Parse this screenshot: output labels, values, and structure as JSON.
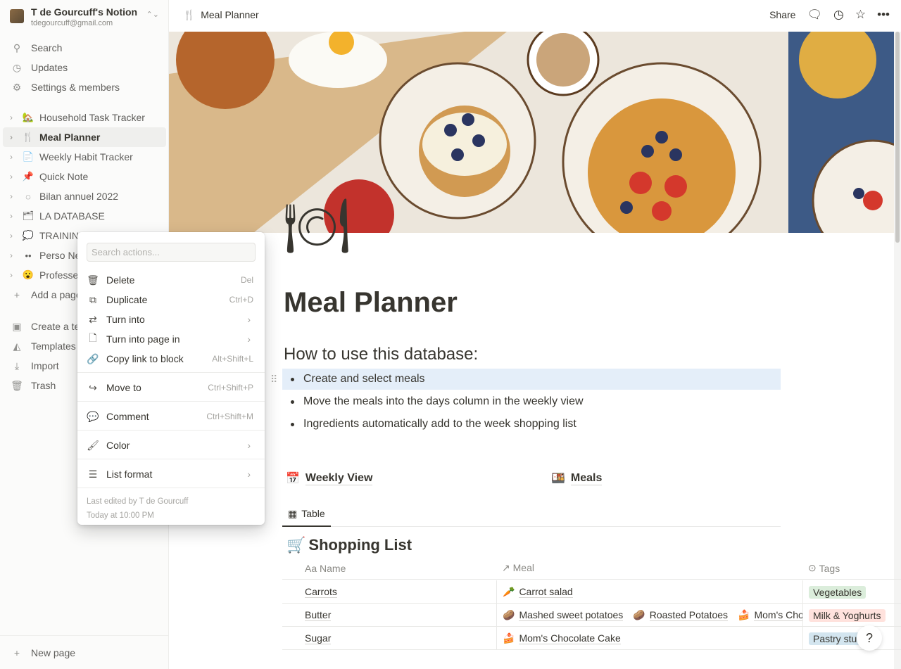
{
  "workspace": {
    "name": "T de Gourcuff's Notion",
    "email": "tdegourcuff@gmail.com"
  },
  "sidebar": {
    "top": [
      {
        "icon": "search-icon",
        "label": "Search"
      },
      {
        "icon": "clock-icon",
        "label": "Updates"
      },
      {
        "icon": "gear-icon",
        "label": "Settings & members"
      }
    ],
    "pages": [
      {
        "emoji": "🏡",
        "label": "Household Task Tracker"
      },
      {
        "emoji": "🍴",
        "label": "Meal Planner",
        "active": true
      },
      {
        "emoji": "📄",
        "label": "Weekly Habit Tracker"
      },
      {
        "emoji": "📌",
        "label": "Quick Note"
      },
      {
        "emoji": "◌",
        "label": "Bilan annuel 2022"
      },
      {
        "emoji": "🗂",
        "label": "LA DATABASE"
      },
      {
        "emoji": "💭",
        "label": "TRAINING"
      },
      {
        "emoji": "••",
        "label": "Perso Ne"
      },
      {
        "emoji": "😮",
        "label": "Professe"
      }
    ],
    "add_page": "Add a page",
    "bottom": [
      {
        "icon": "template-icon",
        "label": "Create a te"
      },
      {
        "icon": "shapes-icon",
        "label": "Templates"
      },
      {
        "icon": "download-icon",
        "label": "Import"
      },
      {
        "icon": "trash-icon",
        "label": "Trash"
      }
    ],
    "new_page": "New page"
  },
  "topbar": {
    "breadcrumb": "Meal Planner",
    "breadcrumb_icon": "🍴",
    "share": "Share"
  },
  "page": {
    "icon": "🍽",
    "title": "Meal Planner",
    "heading": "How to use this database:",
    "bullets": [
      "Create and select meals",
      "Move the meals into the days column in the weekly view",
      "Ingredients automatically add to the week shopping list"
    ],
    "linked": [
      {
        "emoji": "📅",
        "label": "Weekly View"
      },
      {
        "emoji": "🍱",
        "label": "Meals"
      }
    ],
    "view_tab": "Table",
    "db_title": "Shopping List",
    "db_emoji": "🛒",
    "columns": [
      "Aa Name",
      "↗ Meal",
      "Tags"
    ],
    "rows": [
      {
        "name": "Carrots",
        "meals": [
          {
            "e": "🥕",
            "t": "Carrot salad"
          }
        ],
        "tag": "Vegetables",
        "tag_color": "#dbeddb"
      },
      {
        "name": "Butter",
        "meals": [
          {
            "e": "🥔",
            "t": "Mashed sweet potatoes"
          },
          {
            "e": "🥔",
            "t": "Roasted Potatoes"
          },
          {
            "e": "🍰",
            "t": "Mom's Chocolate Cake"
          }
        ],
        "tag": "Milk & Yoghurts",
        "tag_color": "#ffe2dd"
      },
      {
        "name": "Sugar",
        "meals": [
          {
            "e": "🍰",
            "t": "Mom's Chocolate Cake"
          }
        ],
        "tag": "Pastry stuff",
        "tag_color": "#d3e5ef"
      }
    ]
  },
  "menu": {
    "search_placeholder": "Search actions...",
    "items": [
      {
        "icon": "trash-icon",
        "g": "🗑",
        "label": "Delete",
        "shortcut": "Del"
      },
      {
        "icon": "duplicate-icon",
        "g": "⧉",
        "label": "Duplicate",
        "shortcut": "Ctrl+D"
      },
      {
        "icon": "turn-into-icon",
        "g": "⇄",
        "label": "Turn into",
        "submenu": true
      },
      {
        "icon": "page-icon",
        "g": "🗋",
        "label": "Turn into page in",
        "submenu": true
      },
      {
        "icon": "link-icon",
        "g": "🔗",
        "label": "Copy link to block",
        "shortcut": "Alt+Shift+L"
      },
      {
        "icon": "move-icon",
        "g": "↪",
        "label": "Move to",
        "shortcut": "Ctrl+Shift+P"
      },
      {
        "icon": "comment-icon",
        "g": "💬",
        "label": "Comment",
        "shortcut": "Ctrl+Shift+M"
      },
      {
        "icon": "paint-roller-icon",
        "g": "🖌",
        "label": "Color",
        "submenu": true
      },
      {
        "icon": "list-icon",
        "g": "☰",
        "label": "List format",
        "submenu": true
      }
    ],
    "last_edited": "Last edited by T de Gourcuff",
    "edited_time": "Today at 10:00 PM"
  },
  "help": "?"
}
